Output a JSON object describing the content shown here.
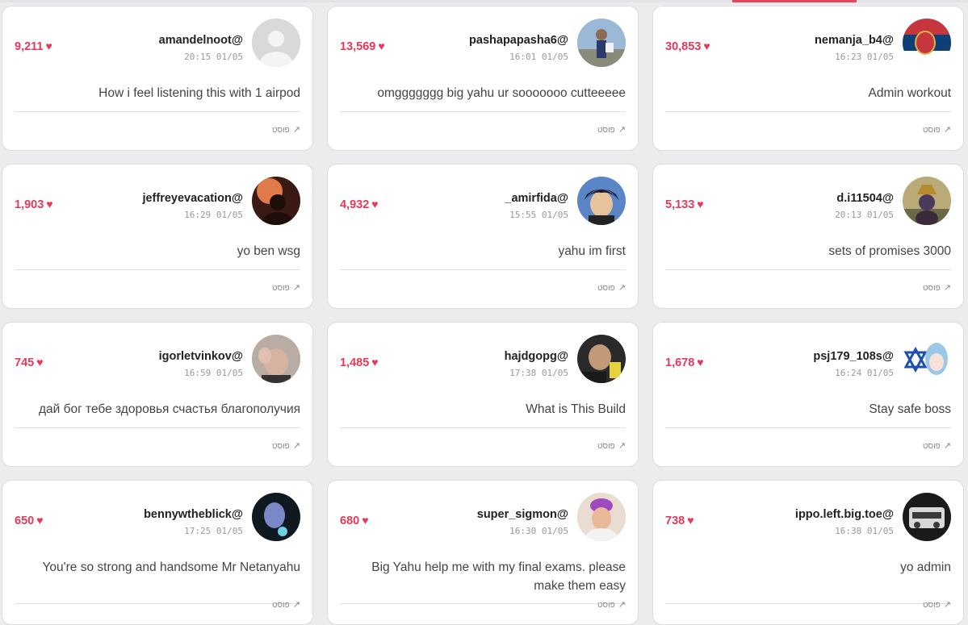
{
  "accent_color": "#e8385a",
  "heart_icon": "heart-icon",
  "link_icon": "external-arrow-icon",
  "cards": [
    {
      "likes": "9,211",
      "username": "amandelnoot@",
      "time": "20:15 01/05",
      "comment": "How i feel listening this with 1 airpod",
      "link": "פוסט"
    },
    {
      "likes": "13,569",
      "username": "pashapapasha6@",
      "time": "16:01 01/05",
      "comment": "omggggggg big yahu ur sooooooo cutteeeee",
      "link": "פוסט"
    },
    {
      "likes": "30,853",
      "username": "nemanja_b4@",
      "time": "16:23 01/05",
      "comment": "Admin workout",
      "link": "פוסט"
    },
    {
      "likes": "1,903",
      "username": "jeffreyevacation@",
      "time": "16:29 01/05",
      "comment": "yo ben wsg",
      "link": "פוסט"
    },
    {
      "likes": "4,932",
      "username": "_amirfida@",
      "time": "15:55 01/05",
      "comment": "yahu im first",
      "link": "פוסט"
    },
    {
      "likes": "5,133",
      "username": "d.i11504@",
      "time": "20:13 01/05",
      "comment": "sets of promises 3000",
      "link": "פוסט"
    },
    {
      "likes": "745",
      "username": "igorletvinkov@",
      "time": "16:59 01/05",
      "comment": "дай бог тебе здоровья счастья благополучия",
      "link": "פוסט"
    },
    {
      "likes": "1,485",
      "username": "hajdgopg@",
      "time": "17:38 01/05",
      "comment": "What is This Build",
      "link": "פוסט"
    },
    {
      "likes": "1,678",
      "username": "psj179_108s@",
      "time": "16:24 01/05",
      "comment": "Stay safe boss",
      "link": "פוסט"
    },
    {
      "likes": "650",
      "username": "bennywtheblick@",
      "time": "17:25 01/05",
      "comment": "You're so strong and handsome Mr Netanyahu",
      "link": "פוסט"
    },
    {
      "likes": "680",
      "username": "super_sigmon@",
      "time": "16:30 01/05",
      "comment": "Big Yahu help me with my final exams. please make them easy",
      "link": "פוסט"
    },
    {
      "likes": "738",
      "username": "ippo.left.big.toe@",
      "time": "16:38 01/05",
      "comment": "yo admin",
      "link": "פוסט"
    }
  ]
}
